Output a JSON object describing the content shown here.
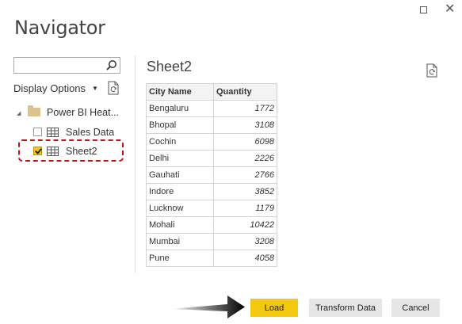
{
  "window": {
    "title": "Navigator",
    "maximize_icon": "maximize-icon",
    "close_icon": "close-icon",
    "close_glyph": "✕"
  },
  "search": {
    "placeholder": "",
    "value": "",
    "icon": "search-icon"
  },
  "display_options": {
    "label": "Display Options",
    "icon": "chevron-down-icon"
  },
  "tree": {
    "root": {
      "label": "Power BI Heat...",
      "icon": "folder-icon",
      "expanded": true
    },
    "items": [
      {
        "label": "Sales Data",
        "checked": false,
        "icon": "table-icon"
      },
      {
        "label": "Sheet2",
        "checked": true,
        "icon": "table-icon",
        "highlighted": true
      }
    ]
  },
  "preview": {
    "title": "Sheet2",
    "columns": [
      "City Name",
      "Quantity"
    ],
    "rows": [
      [
        "Bengaluru",
        "1772"
      ],
      [
        "Bhopal",
        "3108"
      ],
      [
        "Cochin",
        "6098"
      ],
      [
        "Delhi",
        "2226"
      ],
      [
        "Gauhati",
        "2766"
      ],
      [
        "Indore",
        "3852"
      ],
      [
        "Lucknow",
        "1179"
      ],
      [
        "Mohali",
        "10422"
      ],
      [
        "Mumbai",
        "3208"
      ],
      [
        "Pune",
        "4058"
      ]
    ]
  },
  "buttons": {
    "load": "Load",
    "transform": "Transform Data",
    "cancel": "Cancel"
  },
  "colors": {
    "accent": "#f2c811",
    "highlight_border": "#c0141a",
    "button_gray": "#e6e6e6"
  }
}
